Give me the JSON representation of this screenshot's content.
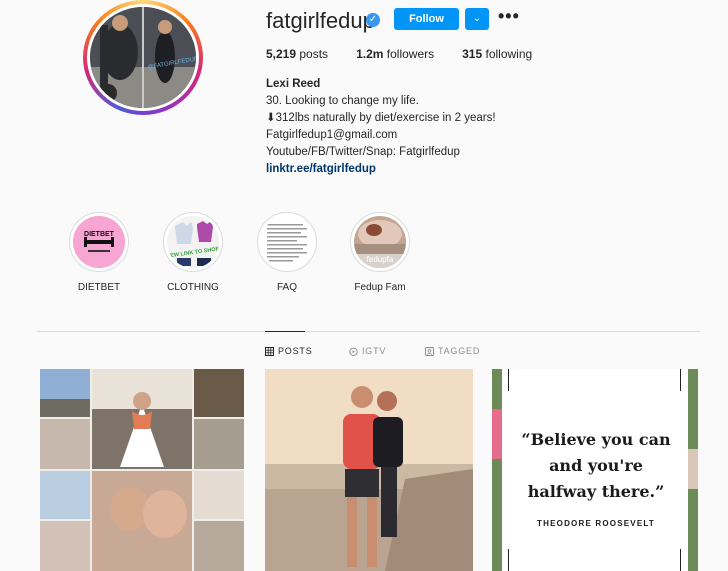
{
  "profile": {
    "username": "fatgirlfedup",
    "follow_label": "Follow",
    "more_glyph": "•••",
    "dropdown_glyph": "⌄"
  },
  "stats": {
    "posts_count": "5,219",
    "posts_label": "posts",
    "followers_count": "1.2m",
    "followers_label": "followers",
    "following_count": "315",
    "following_label": "following"
  },
  "bio": {
    "name": "Lexi Reed",
    "line1": "30. Looking to change my life.",
    "line2": "⬇312lbs naturally by diet/exercise in 2 years!",
    "line3": "Fatgirlfedup1@gmail.com",
    "line4": "Youtube/FB/Twitter/Snap: Fatgirlfedup",
    "link": "linktr.ee/fatgirlfedup"
  },
  "highlights": [
    {
      "label": "DIETBET",
      "img_text": "DIETBET"
    },
    {
      "label": "CLOTHING",
      "img_text": "NEW LINK TO SHOP"
    },
    {
      "label": "FAQ"
    },
    {
      "label": "Fedup Fam",
      "img_text": "fedupfa"
    }
  ],
  "tabs": {
    "posts": "POSTS",
    "igtv": "IGTV",
    "tagged": "TAGGED"
  },
  "quote": {
    "text": "“Believe you can and you're halfway there.”",
    "author": "THEODORE ROOSEVELT"
  },
  "avatar_watermark": "@FATGIRLFEDUP"
}
